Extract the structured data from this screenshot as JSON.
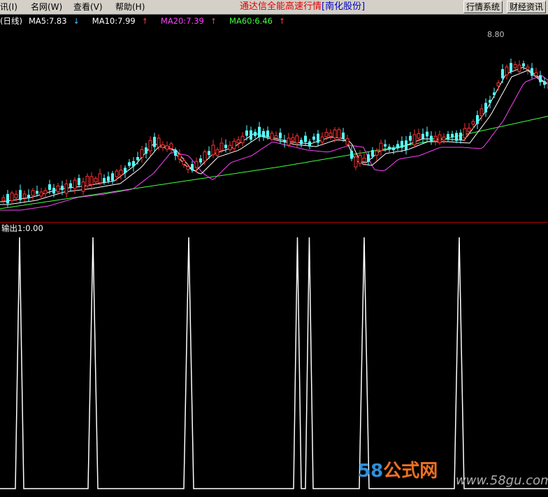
{
  "menu": {
    "items": [
      "讯(I)",
      "名网(W)",
      "查看(V)",
      "帮助(H)"
    ],
    "title_main": "通达信全能高速行情",
    "title_stock": "[南化股份]",
    "buttons": [
      "行情系统",
      "财经资讯"
    ]
  },
  "indicators": {
    "period": "(日线)",
    "ma5": "MA5:7.83",
    "ma10": "MA10:7.99",
    "ma20": "MA20:7.39",
    "ma60": "MA60:6.46",
    "ma5_arrow": "↓",
    "ma10_arrow": "↑",
    "ma20_arrow": "↑",
    "ma60_arrow": "↑",
    "colors": {
      "ma5": "#ffffff",
      "ma10": "#ffffff",
      "ma20": "#ff40ff",
      "ma60": "#40ff40",
      "arrow_up": "#ff4040",
      "arrow_down": "#40c0ff",
      "up_candle": "#ff3030",
      "down_candle": "#54ffff"
    }
  },
  "price_peak_label": "8.80",
  "output": {
    "label": "输出1:0.00",
    "signal_color": "#ffffff"
  },
  "watermark": {
    "brand_num": "58",
    "brand_text": "公式网",
    "url": "www.58gu.com"
  }
}
